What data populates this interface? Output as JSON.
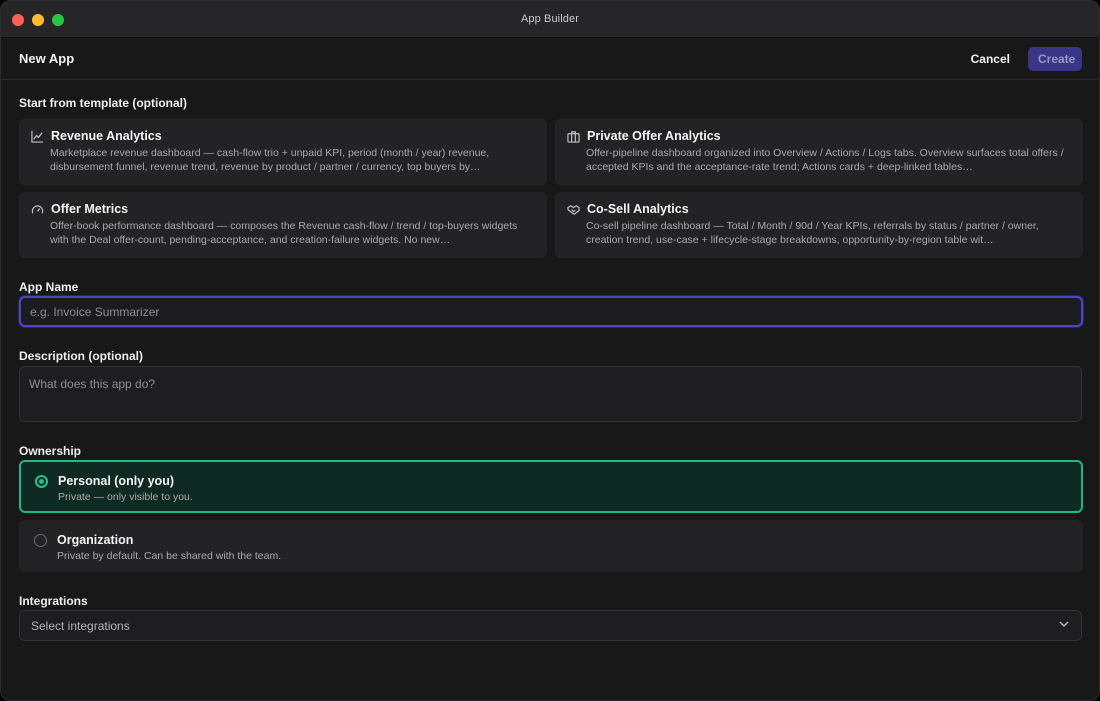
{
  "window": {
    "title": "App Builder"
  },
  "header": {
    "title": "New App",
    "cancel_label": "Cancel",
    "create_label": "Create"
  },
  "templates": {
    "label": "Start from template (optional)",
    "items": [
      {
        "icon": "line-chart-icon",
        "title": "Revenue Analytics",
        "description": "Marketplace revenue dashboard — cash-flow trio + unpaid KPI, period (month / year) revenue, disbursement funnel, revenue trend, revenue by product / partner / currency, top buyers by…"
      },
      {
        "icon": "briefcase-icon",
        "title": "Private Offer Analytics",
        "description": "Offer-pipeline dashboard organized into Overview / Actions / Logs tabs. Overview surfaces total offers / accepted KPIs and the acceptance-rate trend; Actions cards + deep-linked tables…"
      },
      {
        "icon": "gauge-icon",
        "title": "Offer Metrics",
        "description": "Offer-book performance dashboard — composes the Revenue cash-flow / trend / top-buyers widgets with the Deal offer-count, pending-acceptance, and creation-failure widgets. No new…"
      },
      {
        "icon": "handshake-icon",
        "title": "Co-Sell Analytics",
        "description": "Co-sell pipeline dashboard — Total / Month / 90d / Year KPIs, referrals by status / partner / owner, creation trend, use-case + lifecycle-stage breakdowns, opportunity-by-region table wit…"
      }
    ]
  },
  "app_name": {
    "label": "App Name",
    "value": "",
    "placeholder": "e.g. Invoice Summarizer"
  },
  "description": {
    "label": "Description (optional)",
    "value": "",
    "placeholder": "What does this app do?"
  },
  "ownership": {
    "label": "Ownership",
    "selected": "personal",
    "options": [
      {
        "id": "personal",
        "title": "Personal (only you)",
        "subtitle": "Private — only visible to you."
      },
      {
        "id": "organization",
        "title": "Organization",
        "subtitle": "Private by default. Can be shared with the team."
      }
    ]
  },
  "integrations": {
    "label": "Integrations",
    "placeholder": "Select integrations"
  },
  "colors": {
    "accent": "#4c46c7",
    "selected_green": "#1fb883",
    "background": "#181818",
    "card": "#232325"
  }
}
